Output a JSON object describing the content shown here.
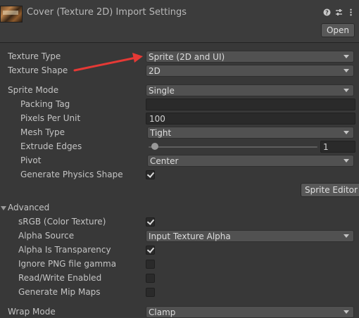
{
  "header": {
    "title": "Cover (Texture 2D) Import Settings",
    "open_label": "Open",
    "icons": [
      "help-icon",
      "presets-icon",
      "more-icon"
    ]
  },
  "fields": {
    "texture_type": {
      "label": "Texture Type",
      "value": "Sprite (2D and UI)"
    },
    "texture_shape": {
      "label": "Texture Shape",
      "value": "2D"
    },
    "sprite_mode": {
      "label": "Sprite Mode",
      "value": "Single"
    },
    "packing_tag": {
      "label": "Packing Tag",
      "value": ""
    },
    "pixels_per_unit": {
      "label": "Pixels Per Unit",
      "value": "100"
    },
    "mesh_type": {
      "label": "Mesh Type",
      "value": "Tight"
    },
    "extrude_edges": {
      "label": "Extrude Edges",
      "value": "1"
    },
    "pivot": {
      "label": "Pivot",
      "value": "Center"
    },
    "generate_physics_shape": {
      "label": "Generate Physics Shape",
      "checked": true
    },
    "sprite_editor_label": "Sprite Editor",
    "advanced_label": "Advanced",
    "srgb": {
      "label": "sRGB (Color Texture)",
      "checked": true
    },
    "alpha_source": {
      "label": "Alpha Source",
      "value": "Input Texture Alpha"
    },
    "alpha_is_transparency": {
      "label": "Alpha Is Transparency",
      "checked": true
    },
    "ignore_png_gamma": {
      "label": "Ignore PNG file gamma",
      "checked": false
    },
    "read_write": {
      "label": "Read/Write Enabled",
      "checked": false
    },
    "generate_mip_maps": {
      "label": "Generate Mip Maps",
      "checked": false
    },
    "wrap_mode": {
      "label": "Wrap Mode",
      "value": "Clamp"
    }
  },
  "annotation": {
    "arrow_color": "#e53935"
  },
  "colors": {
    "background": "#383838",
    "field": "#515151",
    "text": "#c4c4c4"
  }
}
